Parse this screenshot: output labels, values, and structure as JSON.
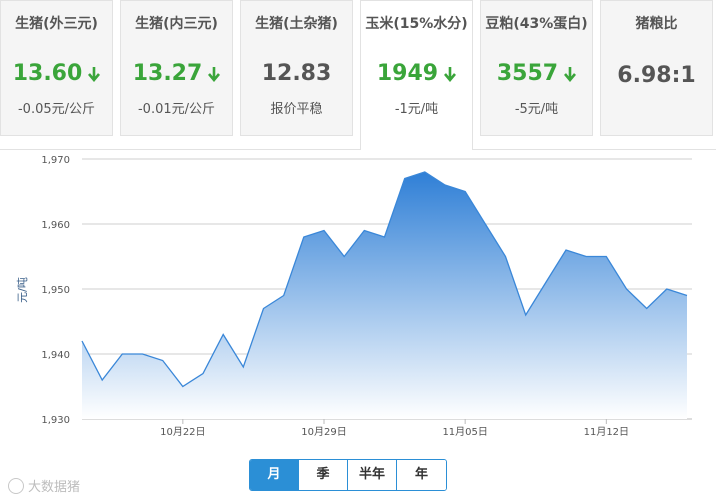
{
  "cards": [
    {
      "title": "生猪(外三元)",
      "price": "13.60",
      "trend": "down",
      "change": "-0.05元/公斤"
    },
    {
      "title": "生猪(内三元)",
      "price": "13.27",
      "trend": "down",
      "change": "-0.01元/公斤"
    },
    {
      "title": "生猪(土杂猪)",
      "price": "12.83",
      "trend": "flat",
      "change": "报价平稳"
    },
    {
      "title": "玉米(15%水分)",
      "price": "1949",
      "trend": "down",
      "change": "-1元/吨"
    },
    {
      "title": "豆粕(43%蛋白)",
      "price": "3557",
      "trend": "down",
      "change": "-5元/吨"
    },
    {
      "title": "猪粮比",
      "price": "6.98:1",
      "trend": "flat",
      "change": ""
    }
  ],
  "colors": {
    "down": "#3aa53a",
    "accent": "#2b8fd6",
    "grid": "#cfcfcf"
  },
  "range_tabs": [
    "月",
    "季",
    "半年",
    "年"
  ],
  "range_active": "月",
  "watermark": "大数据猪",
  "chart_data": {
    "type": "area",
    "title": "",
    "xlabel": "",
    "ylabel": "元/吨",
    "ylim": [
      1930,
      1970
    ],
    "yticks": [
      1930,
      1940,
      1950,
      1960,
      1970
    ],
    "ytick_labels": [
      "1,930",
      "1,940",
      "1,950",
      "1,960",
      "1,970"
    ],
    "x": [
      "10-16",
      "10-17",
      "10-18",
      "10-19",
      "10-20",
      "10-21",
      "10-22",
      "10-23",
      "10-24",
      "10-25",
      "10-26",
      "10-27",
      "10-28",
      "10-29",
      "10-30",
      "10-31",
      "11-01",
      "11-02",
      "11-03",
      "11-04",
      "11-05",
      "11-06",
      "11-07",
      "11-08",
      "11-09",
      "11-10",
      "11-11",
      "11-12",
      "11-13",
      "11-14",
      "11-15",
      "11-16"
    ],
    "values": [
      1942,
      1936,
      1940,
      1940,
      1939,
      1935,
      1937,
      1943,
      1938,
      1947,
      1949,
      1958,
      1959,
      1955,
      1959,
      1958,
      1967,
      1968,
      1966,
      1965,
      1960,
      1955,
      1946,
      1951,
      1956,
      1955,
      1955,
      1950,
      1947,
      1950,
      1949
    ],
    "xticks": [
      {
        "index": 5,
        "label": "10月22日"
      },
      {
        "index": 12,
        "label": "10月29日"
      },
      {
        "index": 19,
        "label": "11月05日"
      },
      {
        "index": 26,
        "label": "11月12日"
      }
    ],
    "grid": true,
    "legend": "none"
  }
}
